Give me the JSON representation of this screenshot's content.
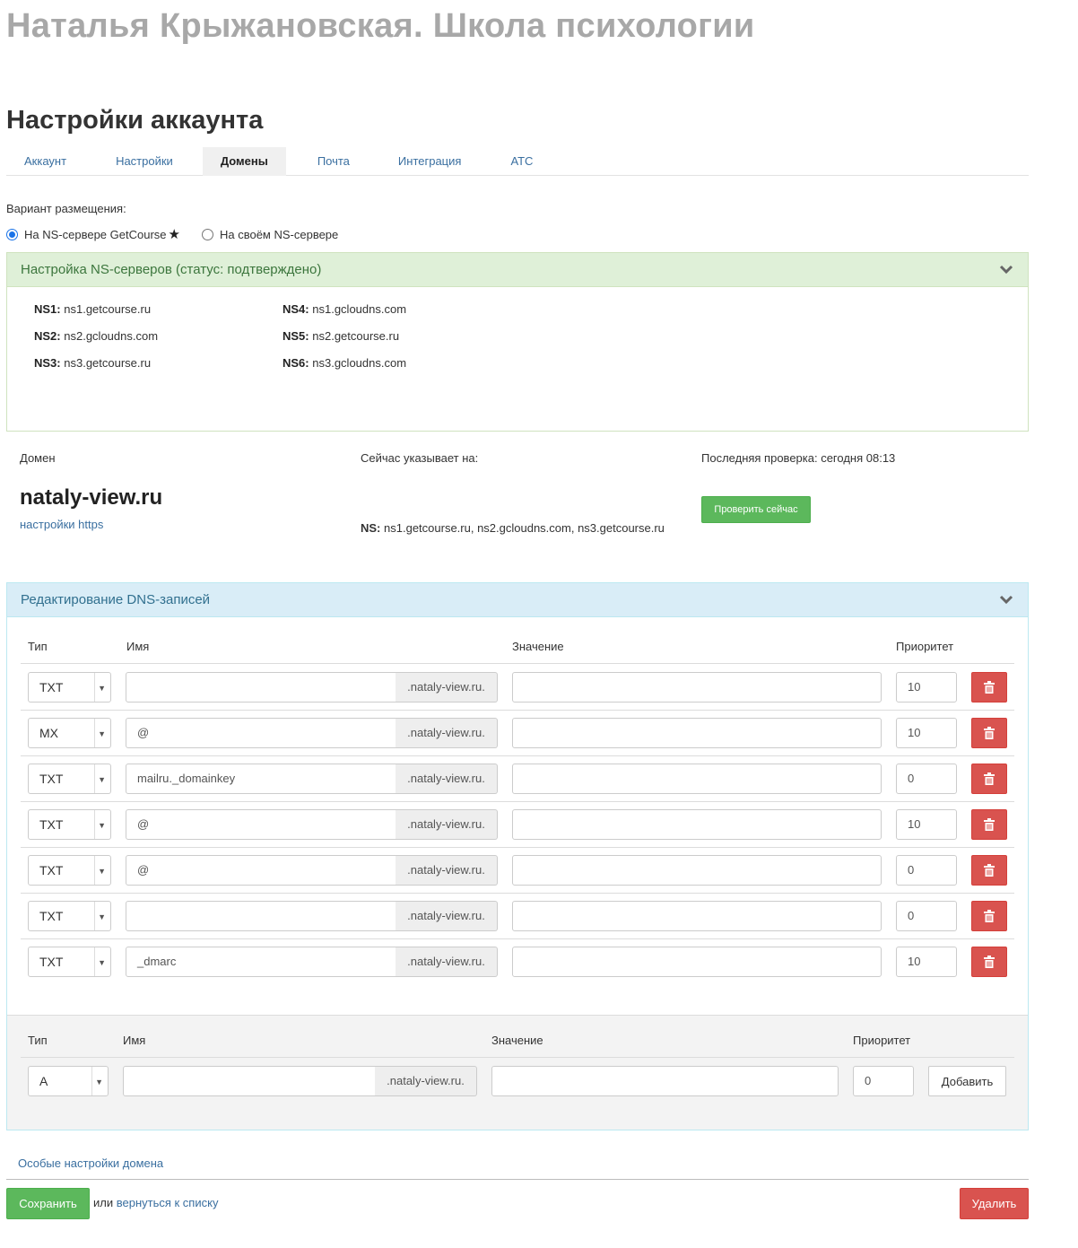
{
  "school": {
    "title": "Наталья Крыжановская. Школа психологии"
  },
  "page": {
    "title": "Настройки аккаунта"
  },
  "tabs": [
    {
      "label": "Аккаунт",
      "active": false
    },
    {
      "label": "Настройки",
      "active": false
    },
    {
      "label": "Домены",
      "active": true
    },
    {
      "label": "Почта",
      "active": false
    },
    {
      "label": "Интеграция",
      "active": false
    },
    {
      "label": "АТС",
      "active": false
    }
  ],
  "placement": {
    "label": "Вариант размещения:",
    "options": [
      {
        "label": "На NS-сервере GetCourse",
        "checked": true,
        "icon": "star-icon",
        "star": "★"
      },
      {
        "label": "На своём NS-сервере",
        "checked": false
      }
    ]
  },
  "ns_panel": {
    "title": "Настройка NS-серверов (статус: подтверждено)",
    "servers": [
      {
        "key": "NS1:",
        "value": "ns1.getcourse.ru"
      },
      {
        "key": "NS2:",
        "value": "ns2.gcloudns.com"
      },
      {
        "key": "NS3:",
        "value": "ns3.getcourse.ru"
      },
      {
        "key": "NS4:",
        "value": "ns1.gcloudns.com"
      },
      {
        "key": "NS5:",
        "value": "ns2.getcourse.ru"
      },
      {
        "key": "NS6:",
        "value": "ns3.gcloudns.com"
      }
    ]
  },
  "domain": {
    "label": "Домен",
    "name": "nataly-view.ru",
    "https_link": "настройки https",
    "points_label": "Сейчас указывает на:",
    "points_ns_key": "NS:",
    "points_ns_value": "ns1.getcourse.ru, ns2.gcloudns.com, ns3.getcourse.ru",
    "last_check": "Последняя проверка: сегодня 08:13",
    "check_button": "Проверить сейчас"
  },
  "dns_panel": {
    "title": "Редактирование DNS-записей",
    "columns": {
      "type": "Тип",
      "name": "Имя",
      "value": "Значение",
      "priority": "Приоритет"
    },
    "suffix": ".nataly-view.ru.",
    "records": [
      {
        "type": "TXT",
        "name": "",
        "value": "",
        "priority": "10"
      },
      {
        "type": "MX",
        "name": "@",
        "value": "",
        "priority": "10"
      },
      {
        "type": "TXT",
        "name": "mailru._domainkey",
        "value": "",
        "priority": "0"
      },
      {
        "type": "TXT",
        "name": "@",
        "value": "",
        "priority": "10"
      },
      {
        "type": "TXT",
        "name": "@",
        "value": "",
        "priority": "0"
      },
      {
        "type": "TXT",
        "name": "",
        "value": "",
        "priority": "0"
      },
      {
        "type": "TXT",
        "name": "_dmarc",
        "value": "",
        "priority": "10"
      }
    ],
    "new_record": {
      "type": "A",
      "name": "",
      "value": "",
      "priority": "0",
      "add_button": "Добавить"
    }
  },
  "footer": {
    "special_settings_link": "Особые настройки домена",
    "save_button": "Сохранить",
    "or_text": "или",
    "back_link": "вернуться к списку",
    "delete_button": "Удалить"
  },
  "colors": {
    "success_panel": "#dff0d8",
    "info_panel": "#d9edf7",
    "green_button": "#5cb85c",
    "red_button": "#d9534f",
    "link": "#3a6fa0"
  }
}
